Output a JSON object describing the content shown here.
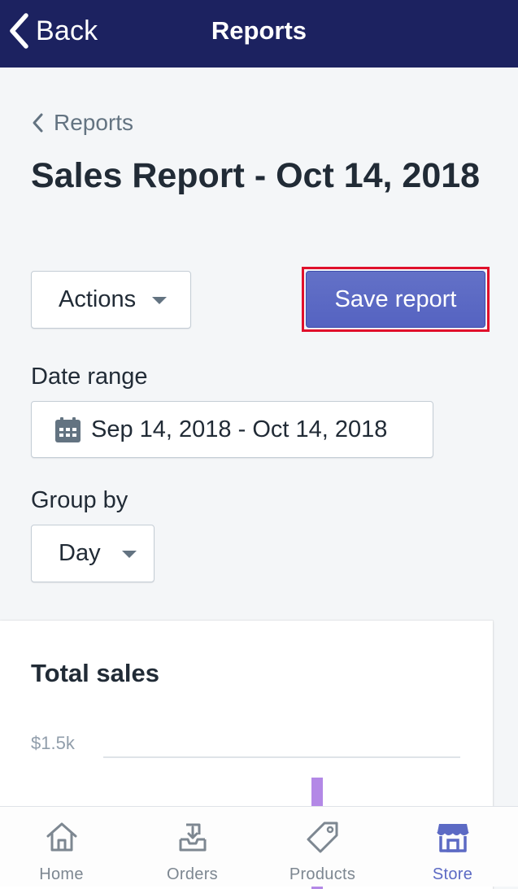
{
  "nav": {
    "back_label": "Back",
    "title": "Reports",
    "background": "#1c2260"
  },
  "breadcrumb": {
    "label": "Reports"
  },
  "page": {
    "title": "Sales Report - Oct 14, 2018"
  },
  "actions": {
    "actions_label": "Actions",
    "save_label": "Save report",
    "save_color": "#5c6ac4",
    "highlight_color": "#e0102b"
  },
  "filters": {
    "date_range_label": "Date range",
    "date_range_value": "Sep 14, 2018 - Oct 14, 2018",
    "date_icon": "calendar-icon",
    "group_by_label": "Group by",
    "group_by_value": "Day"
  },
  "card": {
    "title": "Total sales",
    "y_tick": "$1.5k"
  },
  "chart_data": {
    "type": "bar",
    "title": "Total sales",
    "y_ticks": [
      "$1.5k"
    ],
    "bar_color": "#b388e6"
  },
  "tabbar": {
    "items": [
      {
        "label": "Home",
        "icon": "home-icon",
        "active": false
      },
      {
        "label": "Orders",
        "icon": "orders-icon",
        "active": false
      },
      {
        "label": "Products",
        "icon": "products-tag-icon",
        "active": false
      },
      {
        "label": "Store",
        "icon": "store-icon",
        "active": true
      }
    ],
    "active_color": "#5c6ac4",
    "inactive_color": "#7d8791"
  }
}
